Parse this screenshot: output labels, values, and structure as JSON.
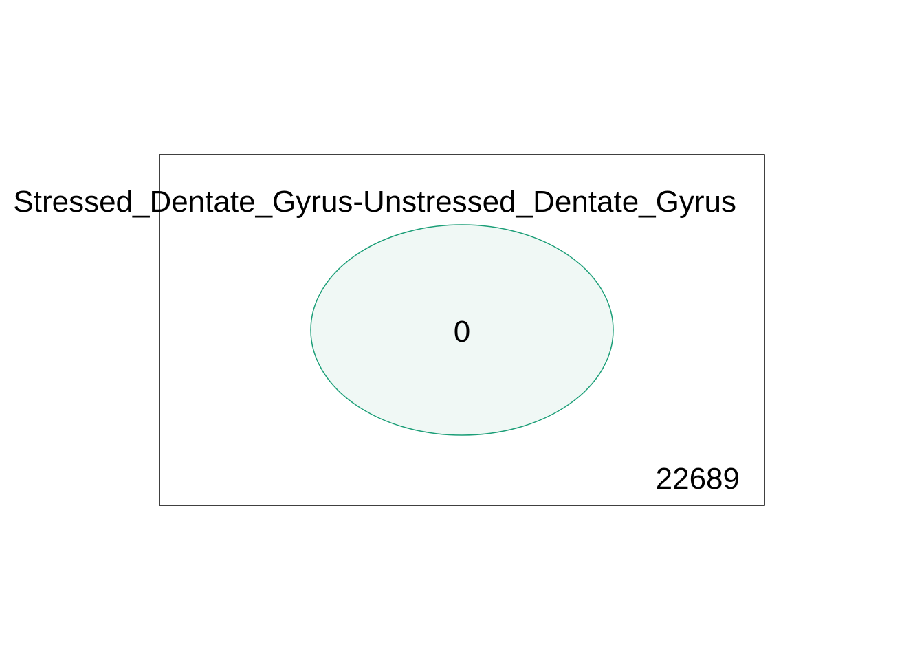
{
  "venn": {
    "set_label": "Stressed_Dentate_Gyrus-Unstressed_Dentate_Gyrus",
    "set_count": "0",
    "outside_count": "22689",
    "colors": {
      "circle_stroke": "#1b9e77",
      "circle_fill": "#f0f8f5",
      "universe_stroke": "#000000",
      "background": "#ffffff"
    }
  }
}
